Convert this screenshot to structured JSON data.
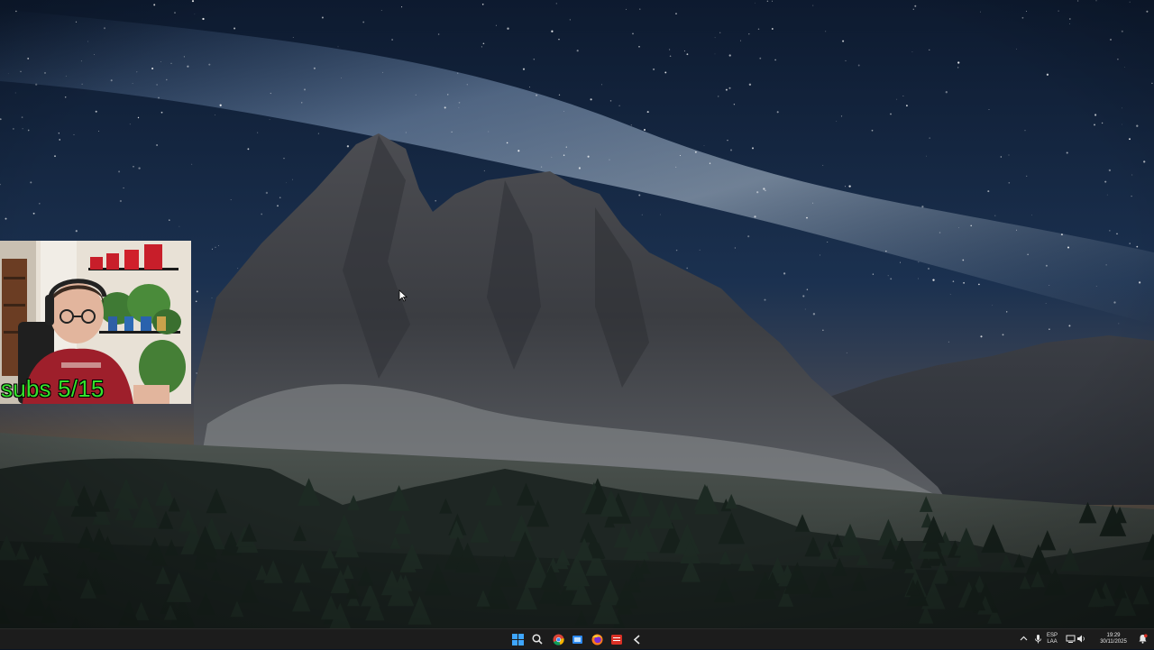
{
  "overlay": {
    "subs_counter": "subs 5/15"
  },
  "taskbar": {
    "pinned": [
      {
        "name": "start",
        "icon": "windows-logo-icon"
      },
      {
        "name": "search",
        "icon": "search-icon"
      },
      {
        "name": "chrome",
        "icon": "chrome-icon"
      },
      {
        "name": "store",
        "icon": "store-icon"
      },
      {
        "name": "firefox",
        "icon": "firefox-icon"
      },
      {
        "name": "recorder",
        "icon": "recorder-icon"
      },
      {
        "name": "other",
        "icon": "app-icon"
      }
    ],
    "tray": {
      "language_line1": "ESP",
      "language_line2": "LAA",
      "time": "19:29",
      "date": "30/11/2025"
    }
  },
  "colors": {
    "subs_text": "#35e12d",
    "taskbar_bg": "#1c1c1c",
    "accent": "#0078d4"
  }
}
